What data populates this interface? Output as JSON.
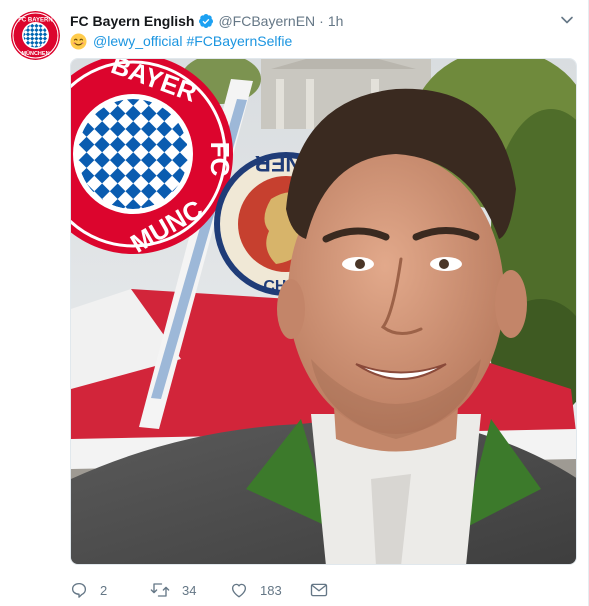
{
  "tweet": {
    "display_name": "FC Bayern English",
    "handle": "@FCBayernEN",
    "separator": "·",
    "timestamp": "1h",
    "mention": "@lewy_official",
    "hashtag": "#FCBayernSelfie",
    "reply_count": "2",
    "retweet_count": "34",
    "like_count": "183"
  },
  "logos": {
    "avatar_ring_text": "FC BAYERN · MÜNCHEN",
    "big_badge_text": "FC BAYERN · MÜNCHEN",
    "beer_sign_text": "PAULANER MÜNCHEN"
  },
  "colors": {
    "bayern_red": "#dc052d",
    "bayern_blue": "#0066b2",
    "link": "#1b95e0",
    "muted": "#657786"
  },
  "icons": [
    "verified-badge-icon",
    "caret-down-icon",
    "smiling-emoji-icon",
    "reply-icon",
    "retweet-icon",
    "like-icon",
    "direct-message-icon"
  ]
}
